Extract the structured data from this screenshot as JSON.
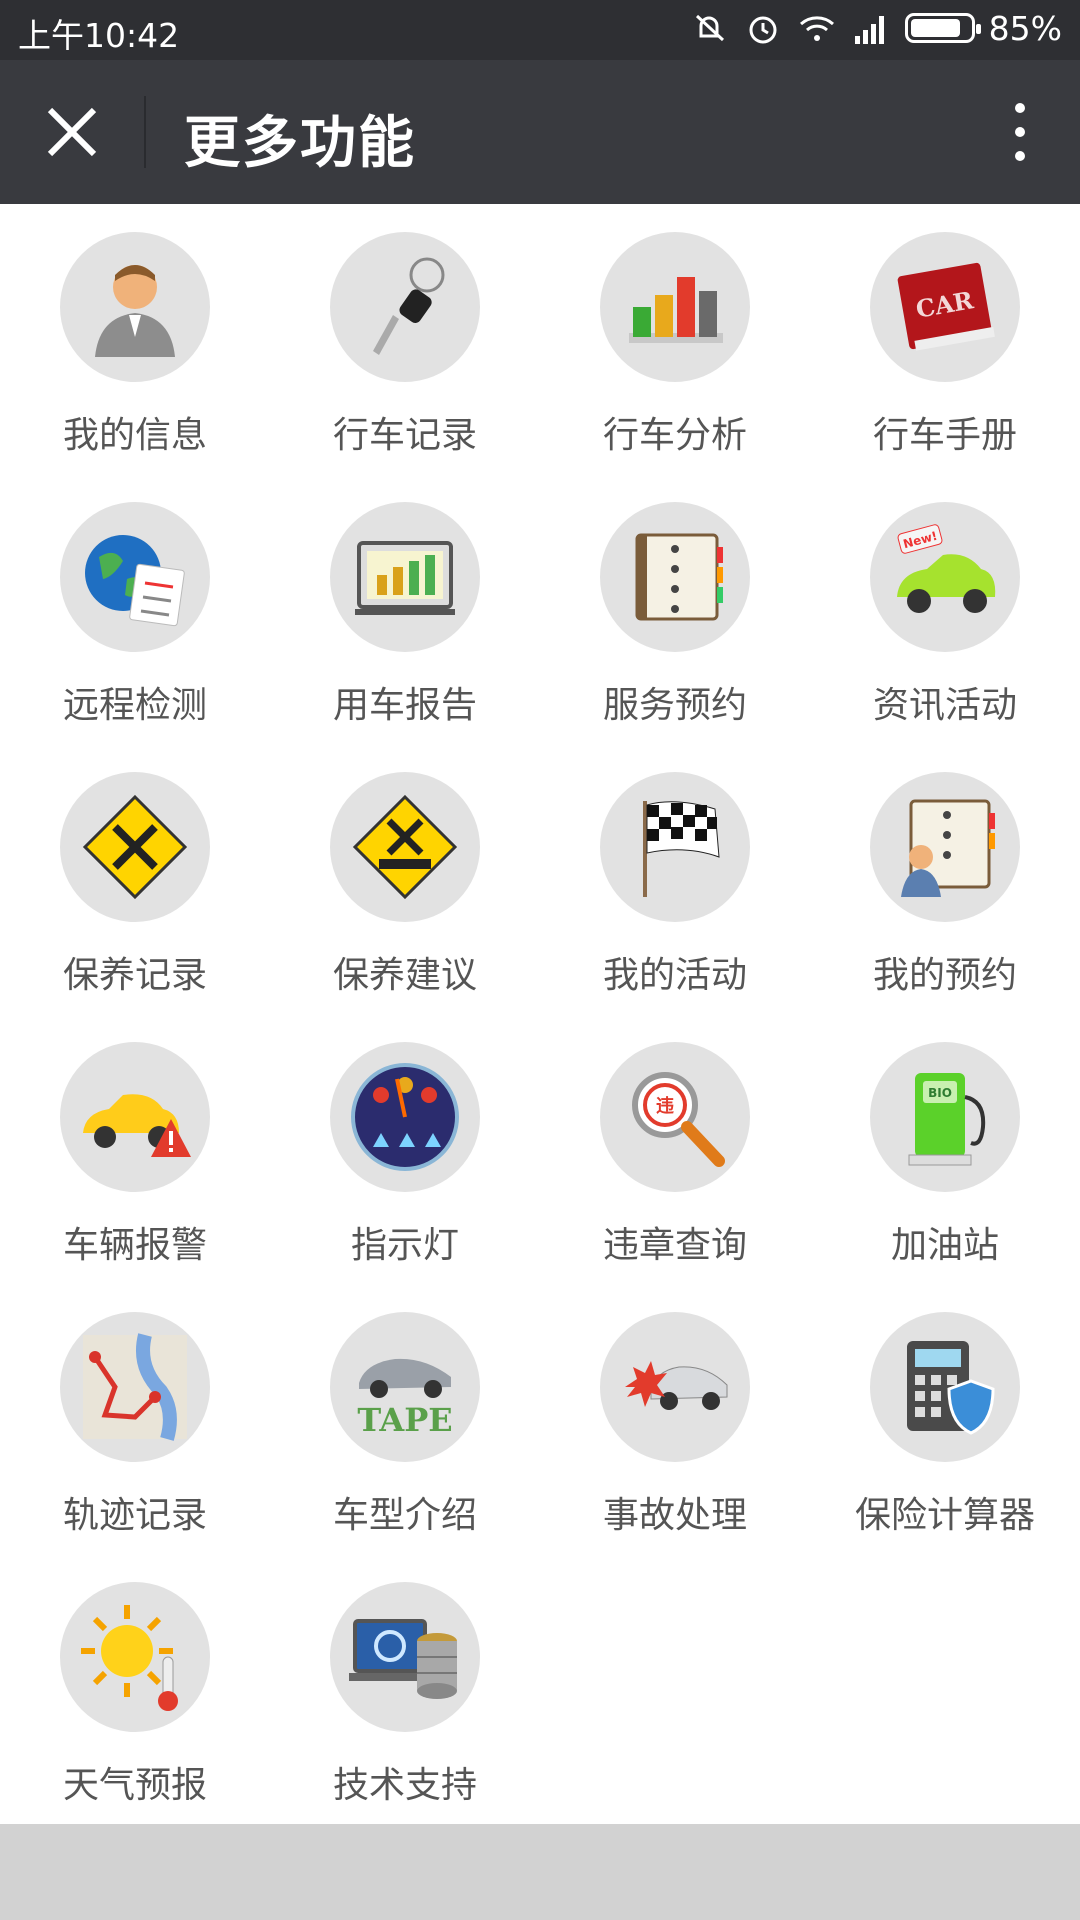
{
  "status_bar": {
    "time": "上午10:42",
    "battery": "85%",
    "battery_level": 0.85
  },
  "header": {
    "title": "更多功能",
    "close_icon": "close-icon",
    "more_icon": "more-vertical-icon"
  },
  "items": [
    {
      "label": "我的信息",
      "icon": "user-profile-icon"
    },
    {
      "label": "行车记录",
      "icon": "car-key-icon"
    },
    {
      "label": "行车分析",
      "icon": "bar-chart-icon"
    },
    {
      "label": "行车手册",
      "icon": "car-book-icon"
    },
    {
      "label": "远程检测",
      "icon": "globe-checklist-icon"
    },
    {
      "label": "用车报告",
      "icon": "report-monitor-icon"
    },
    {
      "label": "服务预约",
      "icon": "notebook-icon"
    },
    {
      "label": "资讯活动",
      "icon": "new-car-icon"
    },
    {
      "label": "保养记录",
      "icon": "maintenance-sign-icon"
    },
    {
      "label": "保养建议",
      "icon": "maintenance-advice-icon"
    },
    {
      "label": "我的活动",
      "icon": "checkered-flag-icon"
    },
    {
      "label": "我的预约",
      "icon": "appointment-book-icon"
    },
    {
      "label": "车辆报警",
      "icon": "car-alert-icon"
    },
    {
      "label": "指示灯",
      "icon": "dashboard-indicator-icon"
    },
    {
      "label": "违章查询",
      "icon": "violation-search-icon"
    },
    {
      "label": "加油站",
      "icon": "fuel-pump-icon"
    },
    {
      "label": "轨迹记录",
      "icon": "route-map-icon"
    },
    {
      "label": "车型介绍",
      "icon": "car-model-icon"
    },
    {
      "label": "事故处理",
      "icon": "car-crash-icon"
    },
    {
      "label": "保险计算器",
      "icon": "insurance-calculator-icon"
    },
    {
      "label": "天气预报",
      "icon": "weather-sun-icon"
    },
    {
      "label": "技术支持",
      "icon": "tech-support-icon"
    }
  ]
}
